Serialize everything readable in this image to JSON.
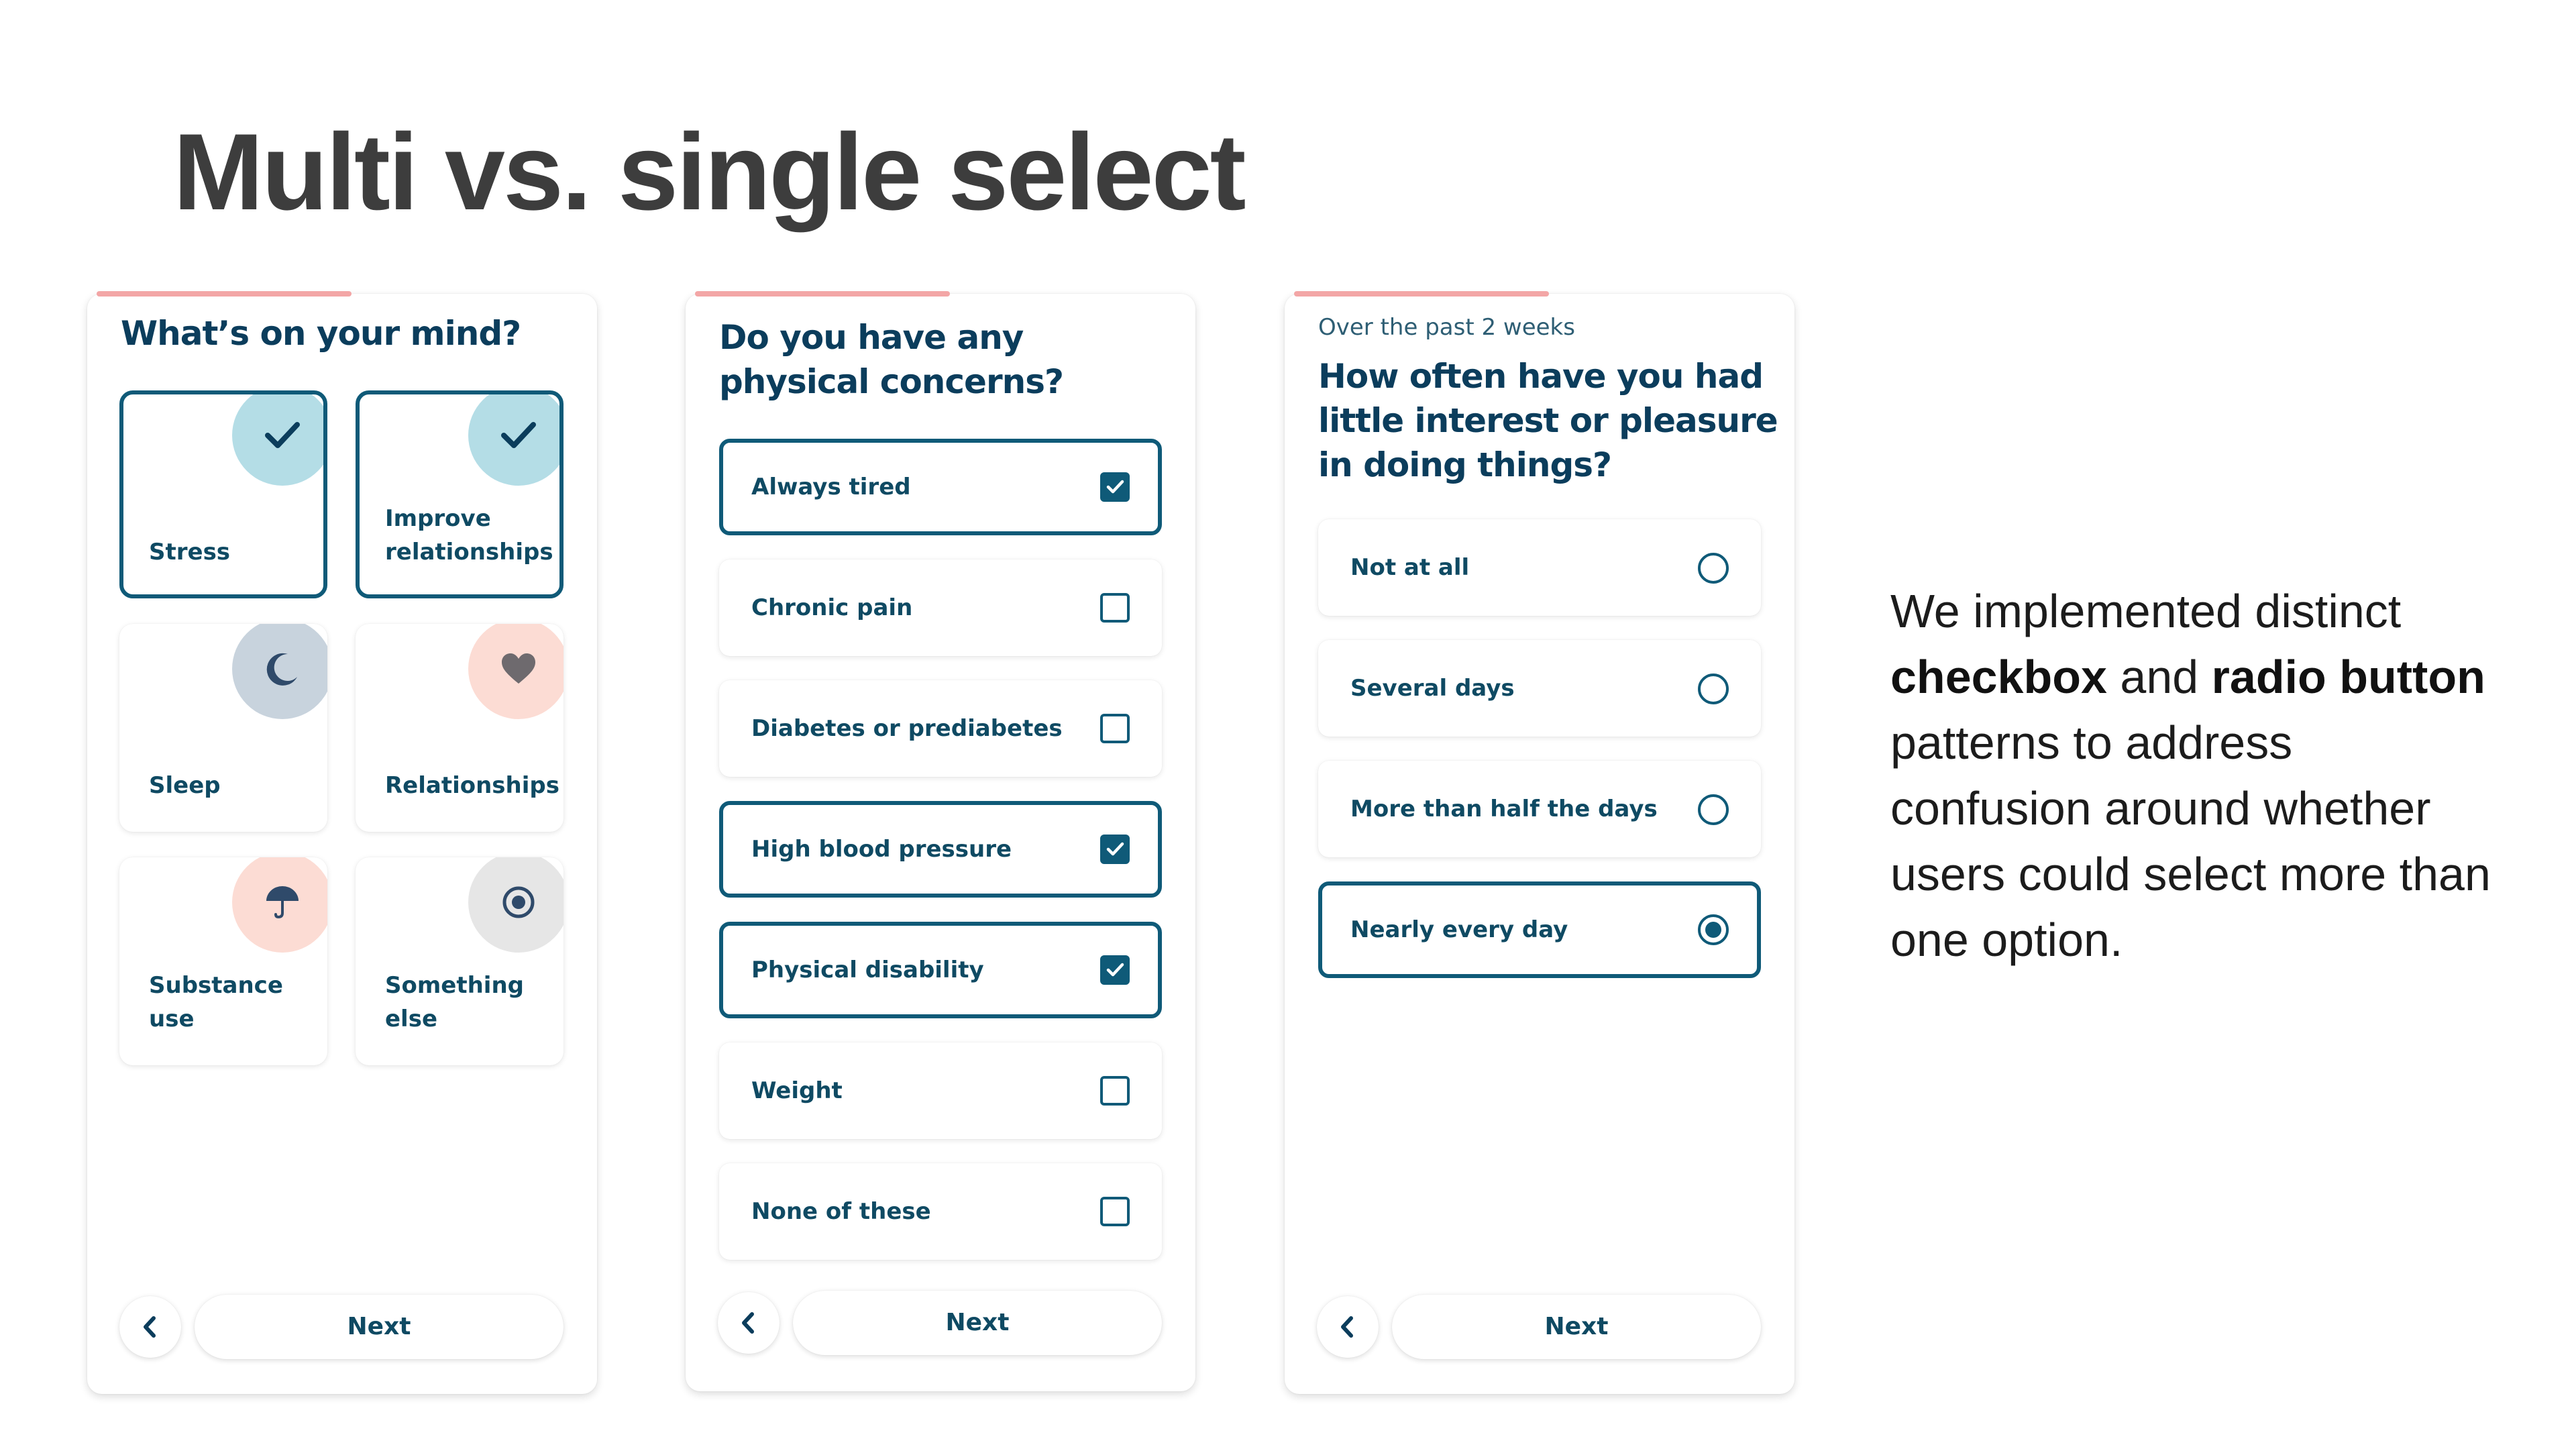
{
  "slide": {
    "title": "Multi vs. single select",
    "caption": {
      "before": "We implemented distinct ",
      "bold1": "checkbox",
      "middle": " and ",
      "bold2": "radio button",
      "after": " patterns to address confusion around whether users could select more than one option."
    }
  },
  "colors": {
    "brand_dark": "#0f5a78",
    "heading": "#0b3d5c",
    "progress": "#f3a6a6",
    "check_circle": "#b4dde6",
    "moon_circle": "#c8d3dd",
    "heart_circle": "#fcdcd4",
    "umbrella_circle": "#fcdcd4",
    "something_circle": "#e6e6e6"
  },
  "screen1": {
    "title": "What’s on your mind?",
    "tiles": [
      {
        "label": "Stress",
        "selected": true,
        "icon": "check-icon"
      },
      {
        "label": "Improve relationships",
        "selected": true,
        "icon": "check-icon"
      },
      {
        "label": "Sleep",
        "selected": false,
        "icon": "moon-icon"
      },
      {
        "label": "Relationships",
        "selected": false,
        "icon": "heart-icon"
      },
      {
        "label": "Substance use",
        "selected": false,
        "icon": "umbrella-icon"
      },
      {
        "label": "Something else",
        "selected": false,
        "icon": "target-icon"
      }
    ],
    "next_label": "Next"
  },
  "screen2": {
    "title_line1": "Do you have any",
    "title_line2": "physical concerns?",
    "options": [
      {
        "label": "Always tired",
        "checked": true
      },
      {
        "label": "Chronic pain",
        "checked": false
      },
      {
        "label": "Diabetes or prediabetes",
        "checked": false
      },
      {
        "label": "High blood pressure",
        "checked": true
      },
      {
        "label": "Physical disability",
        "checked": true
      },
      {
        "label": "Weight",
        "checked": false
      },
      {
        "label": "None of these",
        "checked": false
      }
    ],
    "next_label": "Next"
  },
  "screen3": {
    "subtitle": "Over the past 2 weeks",
    "title_line1": "How often have you had",
    "title_line2": "little interest or pleasure",
    "title_line3": "in doing things?",
    "options": [
      {
        "label": "Not at all",
        "selected": false
      },
      {
        "label": "Several days",
        "selected": false
      },
      {
        "label": "More than half the days",
        "selected": false
      },
      {
        "label": "Nearly every day",
        "selected": true
      }
    ],
    "next_label": "Next"
  }
}
